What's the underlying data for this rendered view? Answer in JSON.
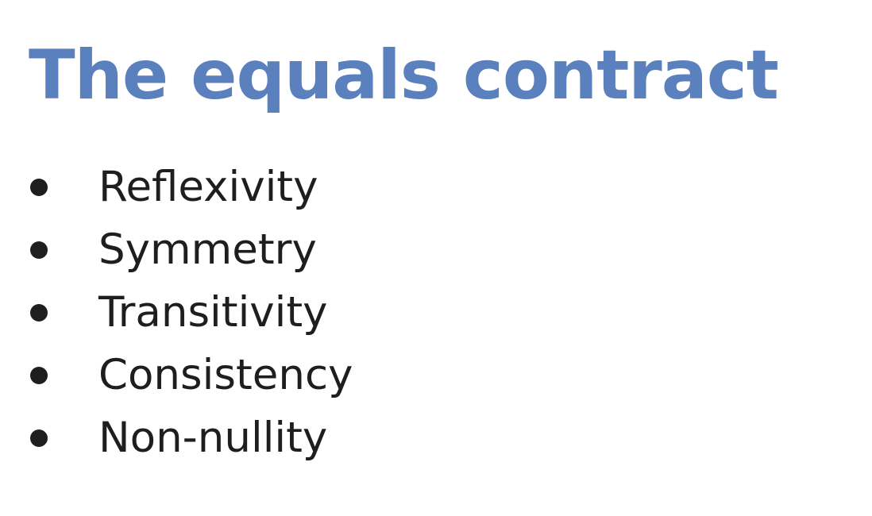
{
  "slide": {
    "title": "The equals contract",
    "title_color": "#5a80bd",
    "bullets": [
      "Reflexivity",
      "Symmetry",
      "Transitivity",
      "Consistency",
      "Non-nullity"
    ]
  }
}
